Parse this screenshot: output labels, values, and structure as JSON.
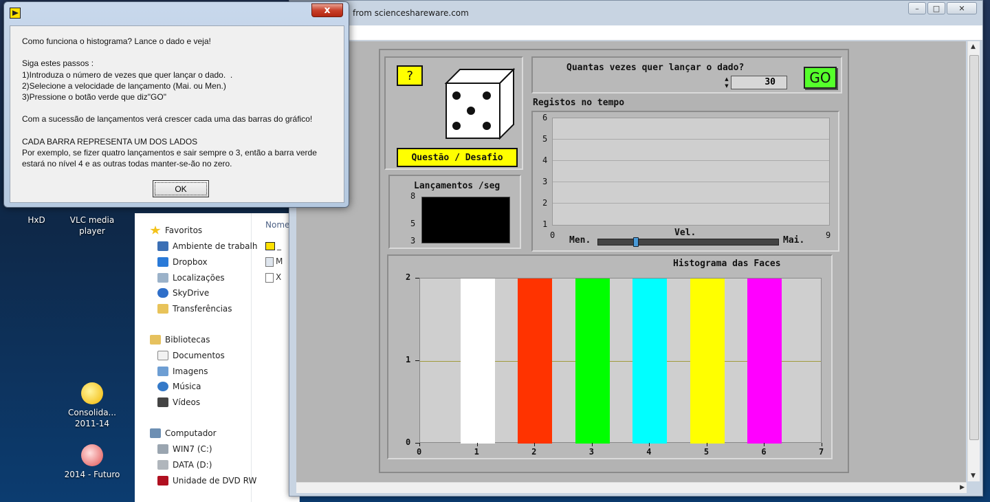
{
  "desktop": {
    "icons": [
      {
        "label": "HxD"
      },
      {
        "label": "VLC media player"
      },
      {
        "label": "Consolida... 2011-14"
      },
      {
        "label": "2014 - Futuro"
      }
    ]
  },
  "explorer": {
    "nav": [
      {
        "label": "Favoritos"
      },
      {
        "label": "Ambiente de trabalh"
      },
      {
        "label": "Dropbox"
      },
      {
        "label": "Localizações"
      },
      {
        "label": "SkyDrive"
      },
      {
        "label": "Transferências"
      },
      {
        "label": "Bibliotecas"
      },
      {
        "label": "Documentos"
      },
      {
        "label": "Imagens"
      },
      {
        "label": "Música"
      },
      {
        "label": "Vídeos"
      },
      {
        "label": "Computador"
      },
      {
        "label": "WIN7 (C:)"
      },
      {
        "label": "DATA (D:)"
      },
      {
        "label": "Unidade de DVD RW"
      }
    ],
    "files_header": "Nome",
    "files": [
      "_",
      "M",
      "X"
    ]
  },
  "browser": {
    "title": "from scienceshareware.com"
  },
  "vi": {
    "help_button": "?",
    "challenge_button": "Questão / Desafio",
    "rate_label": "Lançamentos /seg",
    "rate_ticks": [
      "8",
      "5",
      "3"
    ],
    "count_question": "Quantas vezes quer lançar o dado?",
    "count_value": "30",
    "go_button": "GO",
    "time_chart": {
      "title": "Registos no tempo",
      "y_ticks": [
        "6",
        "5",
        "4",
        "3",
        "2",
        "1"
      ],
      "x_ticks": [
        "0",
        "9"
      ]
    },
    "speed": {
      "label": "Vel.",
      "min_label": "Men.",
      "max_label": "Mai.",
      "value": 0.2
    }
  },
  "chart_data": {
    "type": "bar",
    "title": "Histograma das Faces",
    "categories": [
      "1",
      "2",
      "3",
      "4",
      "5",
      "6"
    ],
    "values": [
      2,
      2,
      2,
      2,
      2,
      2
    ],
    "colors": [
      "#ffffff",
      "#ff3300",
      "#00ff00",
      "#00ffff",
      "#ffff00",
      "#ff00ff"
    ],
    "xlim": [
      0,
      7
    ],
    "ylim": [
      0,
      2
    ],
    "x_ticks": [
      "0",
      "1",
      "2",
      "3",
      "4",
      "5",
      "6",
      "7"
    ],
    "y_ticks": [
      "0",
      "1",
      "2"
    ]
  },
  "dialog": {
    "text": "Como funciona o histograma? Lance o dado e veja!\n\nSiga estes passos :\n1)Introduza o número de vezes que quer lançar o dado.  .\n2)Selecione a velocidade de lançamento (Mai. ou Men.)\n3)Pressione o botão verde que diz\"GO\"\n\nCom a sucessão de lançamentos verá crescer cada uma das barras do gráfico!\n\nCADA BARRA REPRESENTA UM DOS LADOS\nPor exemplo, se fizer quatro lançamentos e sair sempre o 3, então a barra verde\nestará no nível 4 e as outras todas manter-se-ão no zero.",
    "ok_button": "OK",
    "close_label": "x"
  }
}
